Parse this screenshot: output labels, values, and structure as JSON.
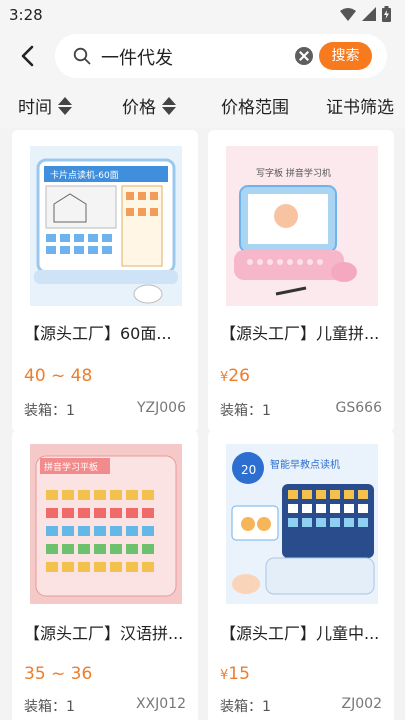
{
  "status_bar": {
    "time": "3:28"
  },
  "search": {
    "query": "一件代发",
    "button_label": "搜索"
  },
  "filters": [
    {
      "label": "时间"
    },
    {
      "label": "价格"
    },
    {
      "label": "价格范围"
    },
    {
      "label": "证书筛选"
    }
  ],
  "products": [
    {
      "title": "【源头工厂】60面...",
      "price": "40 ~ 48",
      "packing": "装箱：1",
      "code": "YZJ006",
      "image_text": "卡片点读机-60面"
    },
    {
      "title": "【源头工厂】儿童拼...",
      "price_symbol": "¥",
      "price": "26",
      "packing": "装箱：1",
      "code": "GS666",
      "image_text": "写字板 拼音学习机"
    },
    {
      "title": "【源头工厂】汉语拼...",
      "price": "35 ~ 36",
      "packing": "装箱：1",
      "code": "XXJ012",
      "image_text": "拼音学习平板"
    },
    {
      "title": "【源头工厂】儿童中...",
      "price_symbol": "¥",
      "price": "15",
      "packing": "装箱：1",
      "code": "ZJ002",
      "image_text": "智能早教点读机"
    }
  ],
  "colors": {
    "accent": "#f77b1e",
    "price": "#ef7d2a"
  }
}
